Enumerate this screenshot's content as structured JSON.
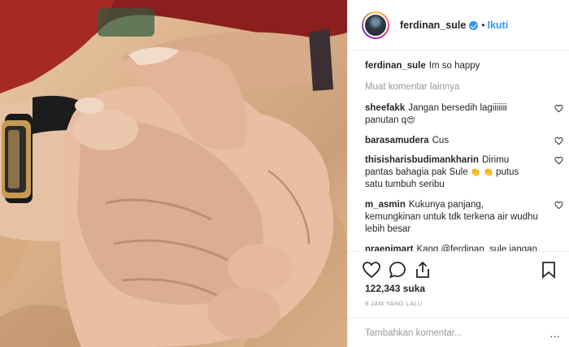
{
  "post": {
    "username": "ferdinan_sule",
    "follow_label": "Ikuti",
    "caption": "Im so happy",
    "load_more": "Muat komentar lainnya"
  },
  "comments": [
    {
      "user": "sheefakk",
      "text": "Jangan bersedih lagiiiiiii panutan q",
      "emoji": "😍"
    },
    {
      "user": "barasamudera",
      "text": "Cus",
      "emoji": ""
    },
    {
      "user": "thisisharisbudimankharin",
      "text": "Dirimu pantas bahagia pak Sule",
      "emoji": "👏 👏",
      "text_after": "putus satu tumbuh seribu"
    },
    {
      "user": "m_asmin",
      "text": "Kukunya panjang, kemungkinan untuk tdk terkena air wudhu lebih besar",
      "emoji": ""
    },
    {
      "user": "nraenimart",
      "text": "Kang @ferdinan_sule jangan lupa buka AsuransiJiwa",
      "emoji": ""
    }
  ],
  "stats": {
    "likes": "122,343 suka",
    "time": "8 JAM YANG LALU"
  },
  "composer": {
    "placeholder": "Tambahkan komentar...",
    "options": "..."
  },
  "icons": {
    "like": "heart-icon",
    "comment": "comment-icon",
    "share": "share-icon",
    "save": "bookmark-icon",
    "verified": "verified-badge-icon"
  },
  "colors": {
    "accent": "#3897f0",
    "muted": "#999999",
    "text": "#262626",
    "divider": "#efefef"
  }
}
